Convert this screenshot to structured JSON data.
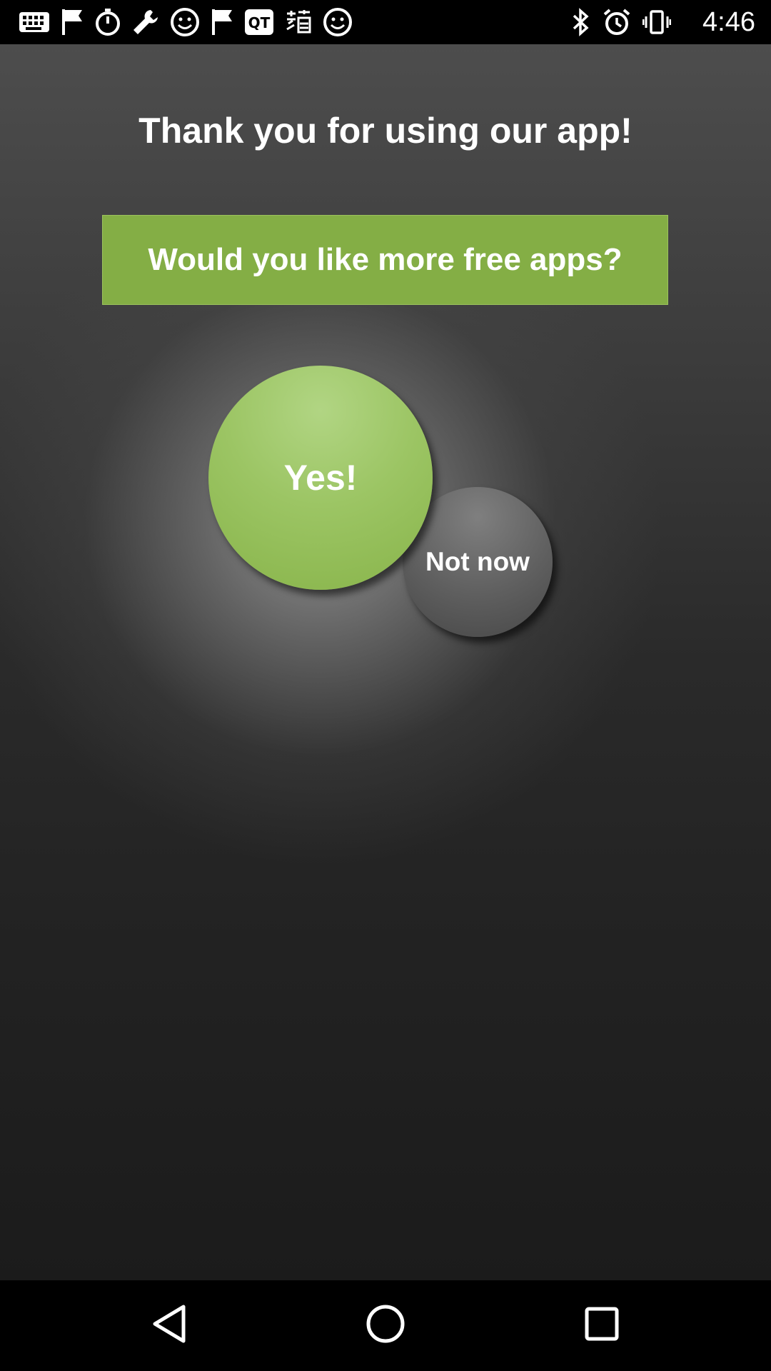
{
  "status_bar": {
    "time": "4:46",
    "left_icons": [
      "keyboard-icon",
      "flag-icon",
      "stopwatch-icon",
      "wrench-icon",
      "smiley-icon",
      "flag-icon",
      "qt-icon",
      "taobao-icon",
      "smiley-icon"
    ],
    "right_icons": [
      "bluetooth-icon",
      "alarm-icon",
      "vibrate-icon"
    ]
  },
  "main": {
    "title": "Thank you for using our app!",
    "banner_text": "Would you like more free apps?",
    "yes_label": "Yes!",
    "not_now_label": "Not now"
  },
  "nav_bar": {
    "items": [
      "back-icon",
      "home-icon",
      "recents-icon"
    ]
  },
  "colors": {
    "accent_green": "#84ae45",
    "yes_button_green": "#9cc564",
    "not_now_gray": "#5f5f5f",
    "background_dark": "#232323"
  }
}
